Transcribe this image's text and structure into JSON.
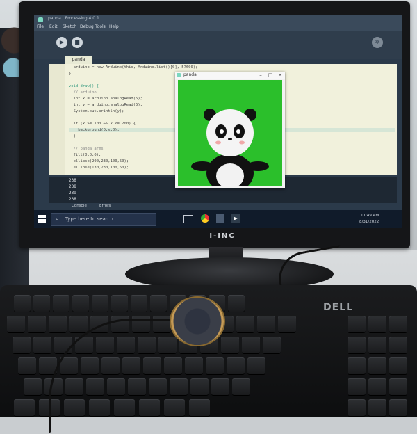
{
  "ide": {
    "window_title": "panda | Processing 4.0.1",
    "menus": [
      "File",
      "Edit",
      "Sketch",
      "Debug",
      "Tools",
      "Help"
    ],
    "tab": "panda",
    "code_lines": [
      "  arduino = new Arduino(this, Arduino.list()[0], 57600);",
      "}",
      "",
      "void draw() {",
      "  // arduino",
      "  int x = arduino.analogRead(5);",
      "  int y = arduino.analogRead(5);",
      "  System.out.println(y);",
      "",
      "  if (x >= 100 && x <= 200) {",
      "    background(0,x,0);",
      "  }",
      "",
      "  // panda arms",
      "  fill(0,0,0);",
      "  ellipse(200,230,100,50);",
      "  ellipse(130,230,100,50);"
    ],
    "console_lines": [
      "238",
      "238",
      "239",
      "238"
    ],
    "console_tabs": [
      "Console",
      "Errors"
    ]
  },
  "sketch_window": {
    "title": "panda",
    "background_color": "#2bbf2b"
  },
  "taskbar": {
    "search_placeholder": "Type here to search",
    "time": "11:49 AM",
    "date": "8/31/2022"
  },
  "monitor": {
    "brand": "I-INC"
  },
  "keyboard": {
    "brand": "DELL"
  }
}
